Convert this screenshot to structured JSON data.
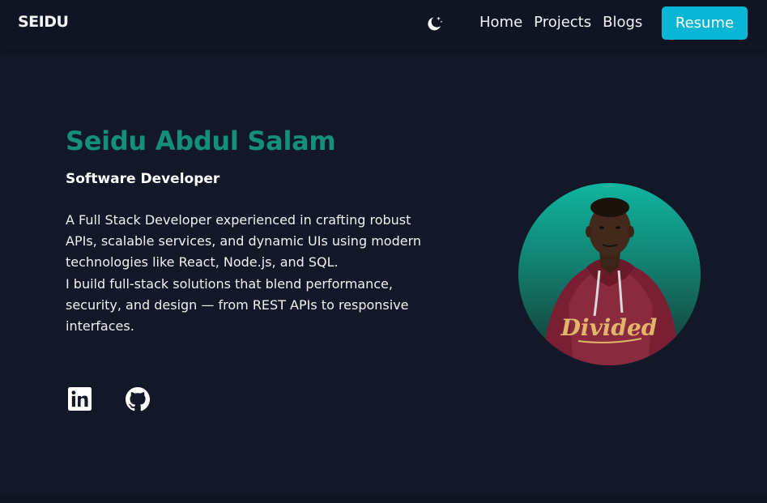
{
  "header": {
    "logo": "SEIDU",
    "theme_icon": "moon-stars-icon",
    "nav": [
      {
        "label": "Home"
      },
      {
        "label": "Projects"
      },
      {
        "label": "Blogs"
      }
    ],
    "resume_label": "Resume"
  },
  "hero": {
    "name": "Seidu Abdul Salam",
    "role": "Software Developer",
    "bio_p1": "A Full Stack Developer experienced in crafting robust APIs, scalable services, and dynamic UIs using modern technologies like React, Node.js, and SQL.",
    "bio_p2": "I build full-stack solutions that blend performance, security, and design — from REST APIs to responsive interfaces.",
    "avatar_shirt_text": "Divided"
  },
  "social": [
    {
      "icon": "linkedin-icon"
    },
    {
      "icon": "github-icon"
    }
  ],
  "colors": {
    "background": "#121827",
    "navbar": "#0f1523",
    "accent": "#14907a",
    "button": "#06b6d4"
  }
}
